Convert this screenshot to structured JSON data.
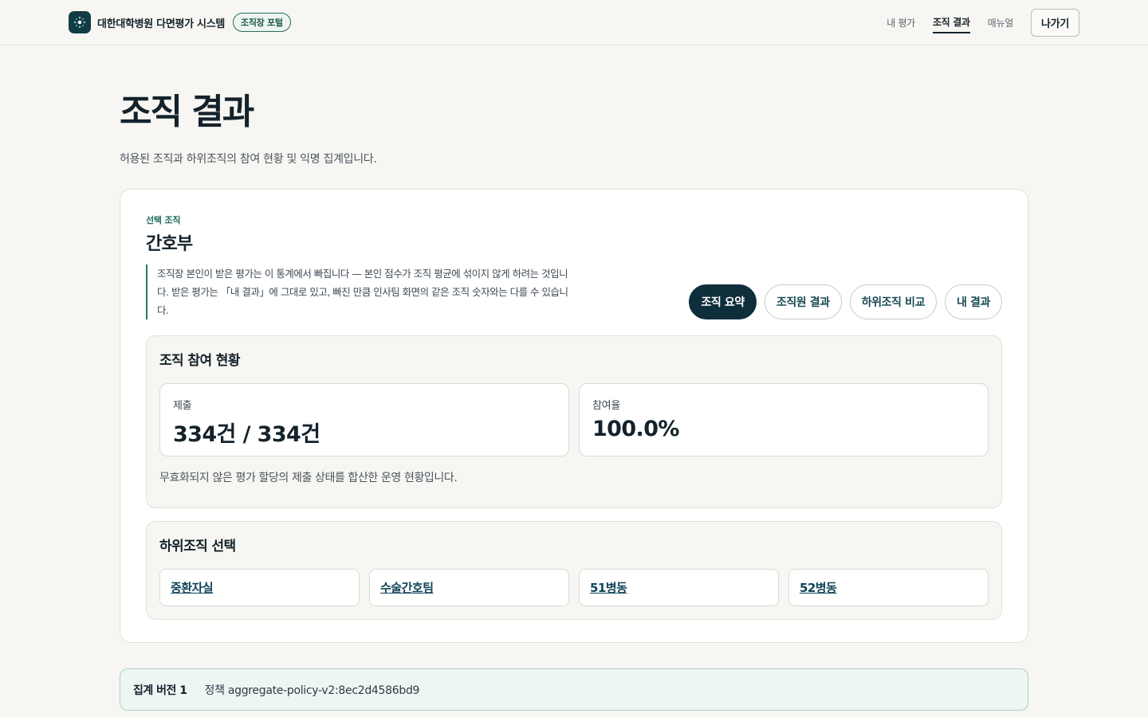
{
  "header": {
    "brand_name": "대한대학병원 다면평가 시스템",
    "portal_badge": "조직장 포털",
    "nav": [
      {
        "label": "내 평가",
        "active": false
      },
      {
        "label": "조직 결과",
        "active": true
      },
      {
        "label": "매뉴얼",
        "active": false
      }
    ],
    "exit_label": "나가기"
  },
  "page": {
    "title": "조직 결과",
    "description": "허용된 조직과 하위조직의 참여 현황 및 익명 집계입니다."
  },
  "org": {
    "eyebrow": "선택 조직",
    "name": "간호부",
    "notice": "조직장 본인이 받은 평가는 이 통계에서 빠집니다 — 본인 점수가 조직 평균에 섞이지 않게 하려는 것입니다. 받은 평가는 「내 결과」에 그대로 있고, 빠진 만큼 인사팀 화면의 같은 조직 숫자와는 다를 수 있습니다."
  },
  "tabs": [
    {
      "label": "조직 요약",
      "active": true
    },
    {
      "label": "조직원 결과",
      "active": false
    },
    {
      "label": "하위조직 비교",
      "active": false
    },
    {
      "label": "내 결과",
      "active": false
    }
  ],
  "participation": {
    "title": "조직 참여 현황",
    "submitted_label": "제출",
    "submitted_value": "334건 / 334건",
    "rate_label": "참여율",
    "rate_value": "100.0%",
    "note": "무효화되지 않은 평가 할당의 제출 상태를 합산한 운영 현황입니다."
  },
  "suborgs": {
    "title": "하위조직 선택",
    "items": [
      "중환자실",
      "수술간호팀",
      "51병동",
      "52병동"
    ]
  },
  "footer": {
    "version": "집계 버전 1",
    "policy": "정책 aggregate-policy-v2:8ec2d4586bd9"
  }
}
